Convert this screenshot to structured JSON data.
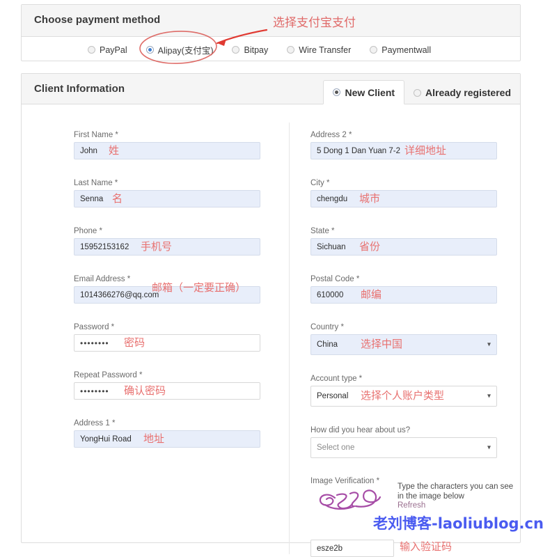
{
  "payment": {
    "title": "Choose payment method",
    "options": [
      {
        "label": "PayPal",
        "selected": false
      },
      {
        "label": "Alipay(支付宝)",
        "selected": true
      },
      {
        "label": "Bitpay",
        "selected": false
      },
      {
        "label": "Wire Transfer",
        "selected": false
      },
      {
        "label": "Paymentwall",
        "selected": false
      }
    ],
    "annotation": "选择支付宝支付"
  },
  "client": {
    "title": "Client Information",
    "tabs": [
      {
        "label": "New Client",
        "selected": true
      },
      {
        "label": "Already registered",
        "selected": false
      }
    ]
  },
  "left_fields": [
    {
      "label": "First Name *",
      "value": "John",
      "filled": true,
      "annotation": "姓"
    },
    {
      "label": "Last Name *",
      "value": "Senna",
      "filled": true,
      "annotation": "名"
    },
    {
      "label": "Phone *",
      "value": "15952153162",
      "filled": true,
      "annotation": "手机号"
    },
    {
      "label": "Email Address *",
      "value": "1014366276@qq.com",
      "filled": true,
      "annotation": "邮箱（一定要正确）"
    },
    {
      "label": "Password *",
      "value": "••••••••",
      "filled": false,
      "annotation": "密码"
    },
    {
      "label": "Repeat Password *",
      "value": "••••••••",
      "filled": false,
      "annotation": "确认密码"
    },
    {
      "label": "Address 1 *",
      "value": "YongHui Road",
      "filled": true,
      "annotation": "地址"
    }
  ],
  "right_fields": [
    {
      "label": "Address 2 *",
      "value": "5 Dong 1 Dan Yuan 7-2",
      "filled": true,
      "select": false,
      "annotation": "详细地址"
    },
    {
      "label": "City *",
      "value": "chengdu",
      "filled": true,
      "select": false,
      "annotation": "城市"
    },
    {
      "label": "State *",
      "value": "Sichuan",
      "filled": true,
      "select": false,
      "annotation": "省份"
    },
    {
      "label": "Postal Code *",
      "value": "610000",
      "filled": true,
      "select": false,
      "annotation": "邮编"
    },
    {
      "label": "Country *",
      "value": "China",
      "filled": true,
      "select": true,
      "annotation": "选择中国"
    },
    {
      "label": "Account type *",
      "value": "Personal",
      "filled": false,
      "select": true,
      "annotation": "选择个人账户类型"
    },
    {
      "label": "How did you hear about us?",
      "value": "Select one",
      "filled": false,
      "select": true,
      "annotation": ""
    }
  ],
  "captcha": {
    "label": "Image Verification *",
    "instruction": "Type the characters you can see in the image below",
    "refresh_label": "Refresh",
    "image_text": "esze2b",
    "input_value": "esze2b",
    "annotation": "输入验证码"
  },
  "watermark": "老刘博客-laoliublog.cn",
  "colors": {
    "annotation_red": "#e8706f",
    "watermark_blue": "#4a5bf0",
    "filled_field": "#e8eefa",
    "panel_head": "#f5f5f5",
    "captcha_purple": "#a64ca6"
  }
}
